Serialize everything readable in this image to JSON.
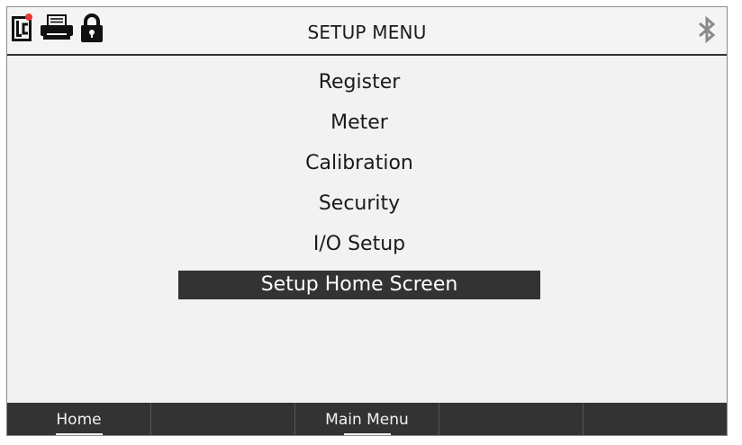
{
  "header": {
    "title": "SETUP MENU",
    "icons": [
      "lc-logo-icon",
      "printer-icon",
      "lock-icon"
    ],
    "right_icon": "bluetooth-icon"
  },
  "menu": {
    "items": [
      {
        "label": "Register",
        "selected": false
      },
      {
        "label": "Meter",
        "selected": false
      },
      {
        "label": "Calibration",
        "selected": false
      },
      {
        "label": "Security",
        "selected": false
      },
      {
        "label": "I/O Setup",
        "selected": false
      },
      {
        "label": "Setup Home Screen",
        "selected": true
      }
    ]
  },
  "footer": {
    "softkeys": [
      {
        "label": "Home",
        "underlined": true
      },
      {
        "label": "",
        "underlined": false
      },
      {
        "label": "Main Menu",
        "underlined": true
      },
      {
        "label": "",
        "underlined": false
      },
      {
        "label": "",
        "underlined": false
      }
    ]
  },
  "colors": {
    "background": "#f2f2f2",
    "bar": "#333333",
    "selected_bg": "#333333",
    "selected_text": "#ffffff",
    "logo_dot": "#e53935",
    "bluetooth": "#8a8a8a"
  }
}
